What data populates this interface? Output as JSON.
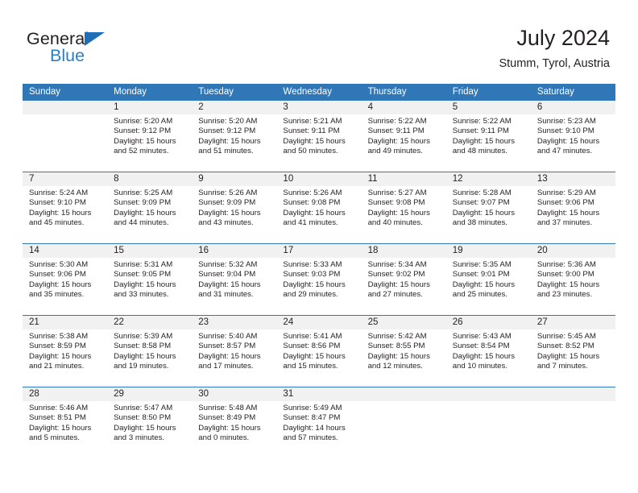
{
  "logo": {
    "word_one": "General",
    "word_two": "Blue",
    "triangle_color": "#1f6fb8",
    "blue_color": "#2a7fc4"
  },
  "header": {
    "title": "July 2024",
    "subtitle": "Stumm, Tyrol, Austria",
    "accent_color": "#3077b8",
    "number_band_color": "#f1f1f1"
  },
  "calendar": {
    "day_headers": [
      "Sunday",
      "Monday",
      "Tuesday",
      "Wednesday",
      "Thursday",
      "Friday",
      "Saturday"
    ],
    "weeks": [
      [
        {
          "day": "",
          "sunrise": "",
          "sunset": "",
          "daylight_line1": "",
          "daylight_line2": ""
        },
        {
          "day": "1",
          "sunrise": "Sunrise: 5:20 AM",
          "sunset": "Sunset: 9:12 PM",
          "daylight_line1": "Daylight: 15 hours",
          "daylight_line2": "and 52 minutes."
        },
        {
          "day": "2",
          "sunrise": "Sunrise: 5:20 AM",
          "sunset": "Sunset: 9:12 PM",
          "daylight_line1": "Daylight: 15 hours",
          "daylight_line2": "and 51 minutes."
        },
        {
          "day": "3",
          "sunrise": "Sunrise: 5:21 AM",
          "sunset": "Sunset: 9:11 PM",
          "daylight_line1": "Daylight: 15 hours",
          "daylight_line2": "and 50 minutes."
        },
        {
          "day": "4",
          "sunrise": "Sunrise: 5:22 AM",
          "sunset": "Sunset: 9:11 PM",
          "daylight_line1": "Daylight: 15 hours",
          "daylight_line2": "and 49 minutes."
        },
        {
          "day": "5",
          "sunrise": "Sunrise: 5:22 AM",
          "sunset": "Sunset: 9:11 PM",
          "daylight_line1": "Daylight: 15 hours",
          "daylight_line2": "and 48 minutes."
        },
        {
          "day": "6",
          "sunrise": "Sunrise: 5:23 AM",
          "sunset": "Sunset: 9:10 PM",
          "daylight_line1": "Daylight: 15 hours",
          "daylight_line2": "and 47 minutes."
        }
      ],
      [
        {
          "day": "7",
          "sunrise": "Sunrise: 5:24 AM",
          "sunset": "Sunset: 9:10 PM",
          "daylight_line1": "Daylight: 15 hours",
          "daylight_line2": "and 45 minutes."
        },
        {
          "day": "8",
          "sunrise": "Sunrise: 5:25 AM",
          "sunset": "Sunset: 9:09 PM",
          "daylight_line1": "Daylight: 15 hours",
          "daylight_line2": "and 44 minutes."
        },
        {
          "day": "9",
          "sunrise": "Sunrise: 5:26 AM",
          "sunset": "Sunset: 9:09 PM",
          "daylight_line1": "Daylight: 15 hours",
          "daylight_line2": "and 43 minutes."
        },
        {
          "day": "10",
          "sunrise": "Sunrise: 5:26 AM",
          "sunset": "Sunset: 9:08 PM",
          "daylight_line1": "Daylight: 15 hours",
          "daylight_line2": "and 41 minutes."
        },
        {
          "day": "11",
          "sunrise": "Sunrise: 5:27 AM",
          "sunset": "Sunset: 9:08 PM",
          "daylight_line1": "Daylight: 15 hours",
          "daylight_line2": "and 40 minutes."
        },
        {
          "day": "12",
          "sunrise": "Sunrise: 5:28 AM",
          "sunset": "Sunset: 9:07 PM",
          "daylight_line1": "Daylight: 15 hours",
          "daylight_line2": "and 38 minutes."
        },
        {
          "day": "13",
          "sunrise": "Sunrise: 5:29 AM",
          "sunset": "Sunset: 9:06 PM",
          "daylight_line1": "Daylight: 15 hours",
          "daylight_line2": "and 37 minutes."
        }
      ],
      [
        {
          "day": "14",
          "sunrise": "Sunrise: 5:30 AM",
          "sunset": "Sunset: 9:06 PM",
          "daylight_line1": "Daylight: 15 hours",
          "daylight_line2": "and 35 minutes."
        },
        {
          "day": "15",
          "sunrise": "Sunrise: 5:31 AM",
          "sunset": "Sunset: 9:05 PM",
          "daylight_line1": "Daylight: 15 hours",
          "daylight_line2": "and 33 minutes."
        },
        {
          "day": "16",
          "sunrise": "Sunrise: 5:32 AM",
          "sunset": "Sunset: 9:04 PM",
          "daylight_line1": "Daylight: 15 hours",
          "daylight_line2": "and 31 minutes."
        },
        {
          "day": "17",
          "sunrise": "Sunrise: 5:33 AM",
          "sunset": "Sunset: 9:03 PM",
          "daylight_line1": "Daylight: 15 hours",
          "daylight_line2": "and 29 minutes."
        },
        {
          "day": "18",
          "sunrise": "Sunrise: 5:34 AM",
          "sunset": "Sunset: 9:02 PM",
          "daylight_line1": "Daylight: 15 hours",
          "daylight_line2": "and 27 minutes."
        },
        {
          "day": "19",
          "sunrise": "Sunrise: 5:35 AM",
          "sunset": "Sunset: 9:01 PM",
          "daylight_line1": "Daylight: 15 hours",
          "daylight_line2": "and 25 minutes."
        },
        {
          "day": "20",
          "sunrise": "Sunrise: 5:36 AM",
          "sunset": "Sunset: 9:00 PM",
          "daylight_line1": "Daylight: 15 hours",
          "daylight_line2": "and 23 minutes."
        }
      ],
      [
        {
          "day": "21",
          "sunrise": "Sunrise: 5:38 AM",
          "sunset": "Sunset: 8:59 PM",
          "daylight_line1": "Daylight: 15 hours",
          "daylight_line2": "and 21 minutes."
        },
        {
          "day": "22",
          "sunrise": "Sunrise: 5:39 AM",
          "sunset": "Sunset: 8:58 PM",
          "daylight_line1": "Daylight: 15 hours",
          "daylight_line2": "and 19 minutes."
        },
        {
          "day": "23",
          "sunrise": "Sunrise: 5:40 AM",
          "sunset": "Sunset: 8:57 PM",
          "daylight_line1": "Daylight: 15 hours",
          "daylight_line2": "and 17 minutes."
        },
        {
          "day": "24",
          "sunrise": "Sunrise: 5:41 AM",
          "sunset": "Sunset: 8:56 PM",
          "daylight_line1": "Daylight: 15 hours",
          "daylight_line2": "and 15 minutes."
        },
        {
          "day": "25",
          "sunrise": "Sunrise: 5:42 AM",
          "sunset": "Sunset: 8:55 PM",
          "daylight_line1": "Daylight: 15 hours",
          "daylight_line2": "and 12 minutes."
        },
        {
          "day": "26",
          "sunrise": "Sunrise: 5:43 AM",
          "sunset": "Sunset: 8:54 PM",
          "daylight_line1": "Daylight: 15 hours",
          "daylight_line2": "and 10 minutes."
        },
        {
          "day": "27",
          "sunrise": "Sunrise: 5:45 AM",
          "sunset": "Sunset: 8:52 PM",
          "daylight_line1": "Daylight: 15 hours",
          "daylight_line2": "and 7 minutes."
        }
      ],
      [
        {
          "day": "28",
          "sunrise": "Sunrise: 5:46 AM",
          "sunset": "Sunset: 8:51 PM",
          "daylight_line1": "Daylight: 15 hours",
          "daylight_line2": "and 5 minutes."
        },
        {
          "day": "29",
          "sunrise": "Sunrise: 5:47 AM",
          "sunset": "Sunset: 8:50 PM",
          "daylight_line1": "Daylight: 15 hours",
          "daylight_line2": "and 3 minutes."
        },
        {
          "day": "30",
          "sunrise": "Sunrise: 5:48 AM",
          "sunset": "Sunset: 8:49 PM",
          "daylight_line1": "Daylight: 15 hours",
          "daylight_line2": "and 0 minutes."
        },
        {
          "day": "31",
          "sunrise": "Sunrise: 5:49 AM",
          "sunset": "Sunset: 8:47 PM",
          "daylight_line1": "Daylight: 14 hours",
          "daylight_line2": "and 57 minutes."
        },
        {
          "day": "",
          "sunrise": "",
          "sunset": "",
          "daylight_line1": "",
          "daylight_line2": ""
        },
        {
          "day": "",
          "sunrise": "",
          "sunset": "",
          "daylight_line1": "",
          "daylight_line2": ""
        },
        {
          "day": "",
          "sunrise": "",
          "sunset": "",
          "daylight_line1": "",
          "daylight_line2": ""
        }
      ]
    ]
  }
}
